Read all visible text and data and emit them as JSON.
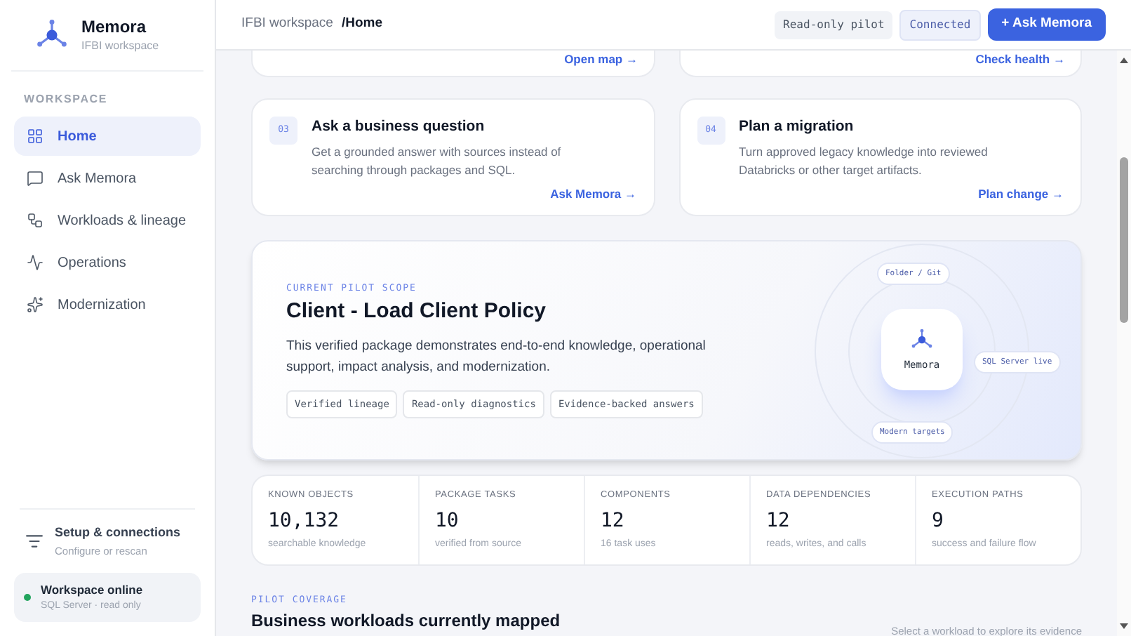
{
  "brand": {
    "name": "Memora",
    "subtitle": "IFBI workspace"
  },
  "sidebar": {
    "section": "WORKSPACE",
    "items": [
      {
        "label": "Home",
        "selected": true
      },
      {
        "label": "Ask Memora",
        "selected": false
      },
      {
        "label": "Workloads & lineage",
        "selected": false
      },
      {
        "label": "Operations",
        "selected": false
      },
      {
        "label": "Modernization",
        "selected": false
      }
    ],
    "setup": {
      "title": "Setup & connections",
      "subtitle": "Configure or rescan"
    },
    "status": {
      "title": "Workspace online",
      "subtitle": "SQL Server · read only",
      "color": "#22a45d"
    }
  },
  "header": {
    "breadcrumb": [
      "IFBI workspace",
      "/Home"
    ],
    "badges": [
      "Read-only pilot",
      "Connected"
    ],
    "button": "+ Ask Memora"
  },
  "top_cards": [
    {
      "link": "Open map →"
    },
    {
      "link": "Check health →"
    }
  ],
  "cards": [
    {
      "number": "03",
      "title": "Ask a business question",
      "text": "Get a grounded answer with sources instead of searching through packages and SQL.",
      "link": "Ask Memora →"
    },
    {
      "number": "04",
      "title": "Plan a migration",
      "text": "Turn approved legacy knowledge into reviewed Databricks or other target artifacts.",
      "link": "Plan change →"
    }
  ],
  "hero": {
    "eyebrow": "CURRENT PILOT SCOPE",
    "title": "Client - Load Client Policy",
    "text": "This verified package demonstrates end-to-end knowledge, operational support, impact analysis, and modernization.",
    "tags": [
      "Verified lineage",
      "Read-only diagnostics",
      "Evidence-backed answers"
    ],
    "diagram": {
      "center": "Memora",
      "top": "Folder / Git",
      "right": "SQL Server live",
      "bottom": "Modern targets"
    }
  },
  "stats": [
    {
      "label": "KNOWN OBJECTS",
      "value": "10,132",
      "note": "searchable knowledge"
    },
    {
      "label": "PACKAGE TASKS",
      "value": "10",
      "note": "verified from source"
    },
    {
      "label": "COMPONENTS",
      "value": "12",
      "note": "16 task uses"
    },
    {
      "label": "DATA DEPENDENCIES",
      "value": "12",
      "note": "reads, writes, and calls"
    },
    {
      "label": "EXECUTION PATHS",
      "value": "9",
      "note": "success and failure flow"
    }
  ],
  "coverage": {
    "eyebrow": "PILOT COVERAGE",
    "title": "Business workloads currently mapped",
    "hint": "Select a workload to explore its evidence"
  }
}
